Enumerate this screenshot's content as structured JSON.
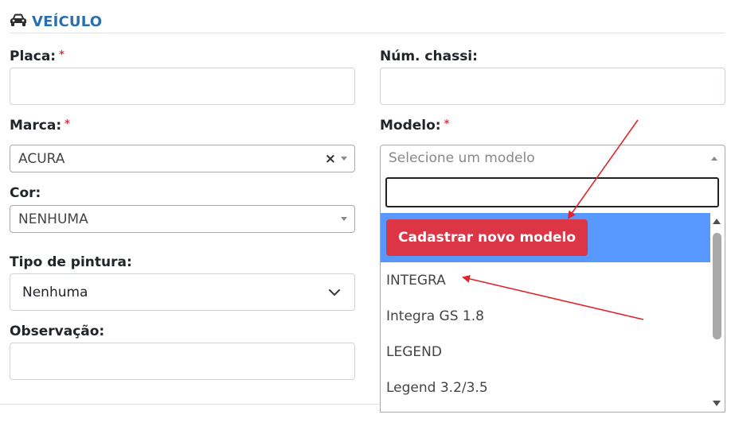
{
  "section": {
    "title": "VEÍCULO",
    "icon": "car-icon"
  },
  "required_mark": "*",
  "fields": {
    "placa": {
      "label": "Placa:",
      "value": ""
    },
    "chassi": {
      "label": "Núm. chassi:",
      "value": ""
    },
    "marca": {
      "label": "Marca:",
      "value": "ACURA",
      "clear": "×"
    },
    "modelo": {
      "label": "Modelo:",
      "placeholder": "Selecione um modelo"
    },
    "cor": {
      "label": "Cor:",
      "value": "NENHUMA"
    },
    "tipo_pintura": {
      "label": "Tipo de pintura:",
      "value": "Nenhuma"
    },
    "observacao": {
      "label": "Observação:",
      "value": ""
    }
  },
  "dropdown": {
    "search_value": "",
    "new_button": "Cadastrar novo modelo",
    "options": [
      "INTEGRA",
      "Integra GS 1.8",
      "LEGEND",
      "Legend 3.2/3.5"
    ]
  },
  "annotation_color": "#e0252b",
  "highlight_color": "#5897fb",
  "button_color": "#dc3545"
}
